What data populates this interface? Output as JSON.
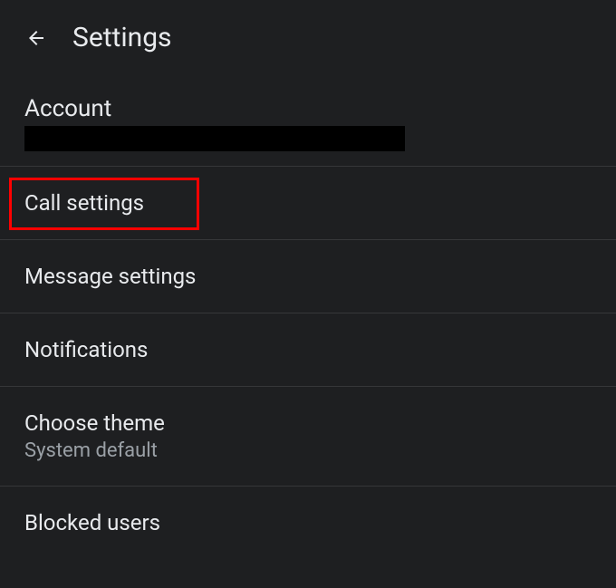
{
  "header": {
    "title": "Settings"
  },
  "account": {
    "label": "Account"
  },
  "items": [
    {
      "title": "Call settings",
      "highlighted": true
    },
    {
      "title": "Message settings"
    },
    {
      "title": "Notifications"
    },
    {
      "title": "Choose theme",
      "subtitle": "System default"
    },
    {
      "title": "Blocked users"
    }
  ]
}
